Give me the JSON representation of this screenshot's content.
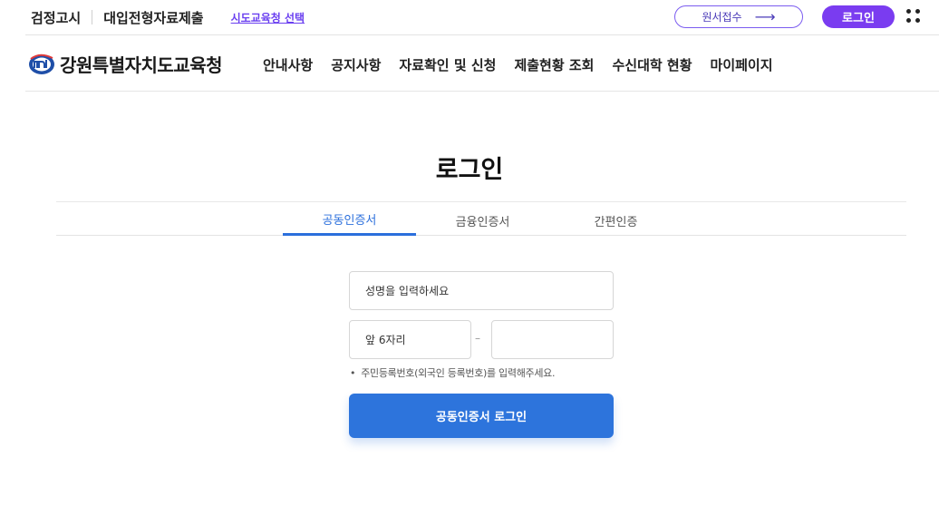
{
  "topbar": {
    "link1": "검정고시",
    "link2": "대입전형자료제출",
    "select_office": "시도교육청 선택",
    "apply_button": "원서접수",
    "apply_arrow": "⟶",
    "login_button": "로그인"
  },
  "header": {
    "brand": "강원특별자치도교육청",
    "nav": [
      "안내사항",
      "공지사항",
      "자료확인 및 신청",
      "제출현황 조회",
      "수신대학 현황",
      "마이페이지"
    ]
  },
  "page": {
    "title": "로그인"
  },
  "tabs": [
    {
      "label": "공동인증서",
      "active": true
    },
    {
      "label": "금융인증서",
      "active": false
    },
    {
      "label": "간편인증",
      "active": false
    }
  ],
  "form": {
    "name_placeholder": "성명을 입력하세요",
    "front_placeholder": "앞 6자리",
    "back_placeholder": "",
    "dash": "–",
    "notice_bullet": "•",
    "notice": "주민등록번호(외국인 등록번호)를 입력해주세요.",
    "submit": "공동인증서 로그인"
  },
  "colors": {
    "accent_purple": "#7a3cf0",
    "primary_blue": "#2d74dc"
  }
}
